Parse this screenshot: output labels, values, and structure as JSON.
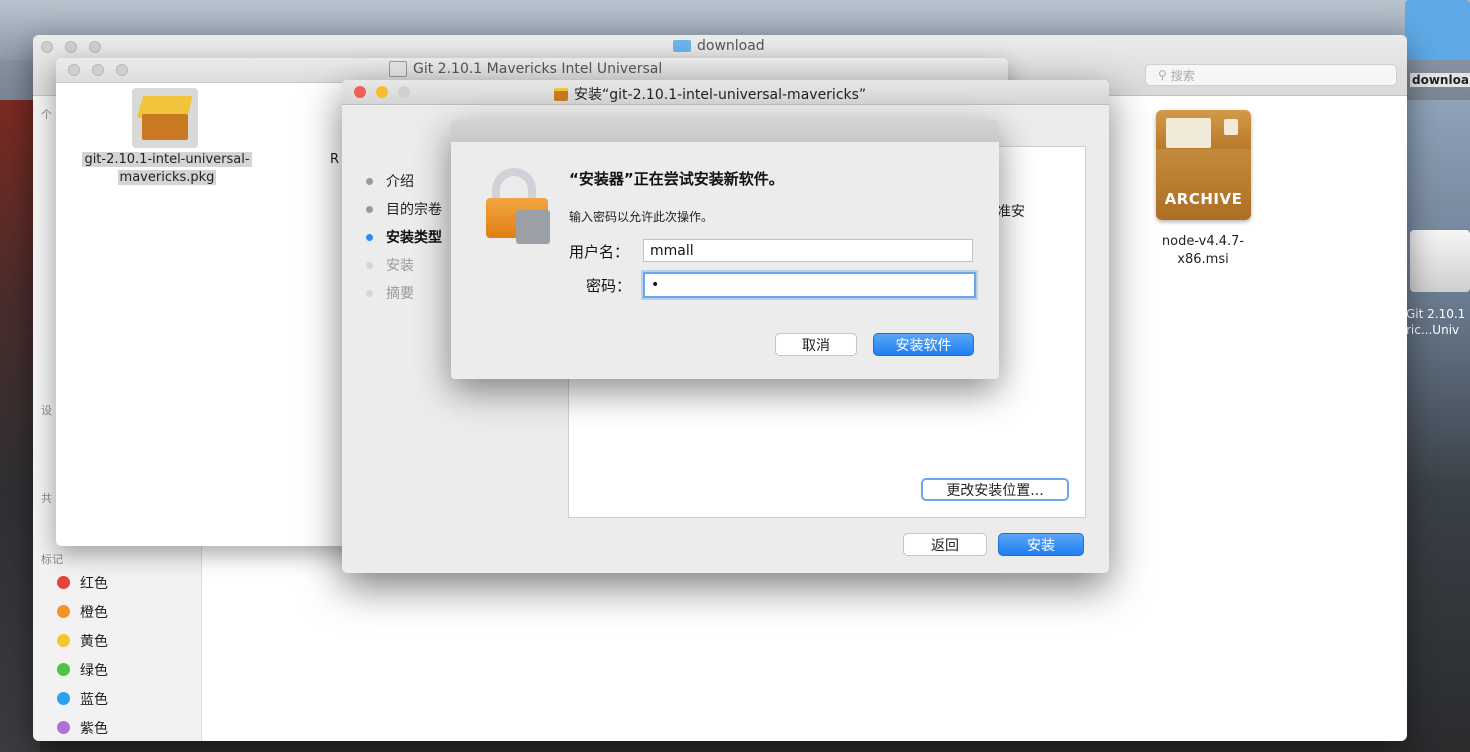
{
  "finder": {
    "title": "download",
    "search_placeholder": "搜索",
    "sidebar": {
      "section_tags": "标记",
      "section_favorites": "个",
      "section_devices": "设",
      "section_shared": "共",
      "tags": [
        {
          "label": "红色",
          "color": "#e8423a"
        },
        {
          "label": "橙色",
          "color": "#f0952c"
        },
        {
          "label": "黄色",
          "color": "#f3c531"
        },
        {
          "label": "绿色",
          "color": "#4cc640"
        },
        {
          "label": "蓝色",
          "color": "#2f9ff0"
        },
        {
          "label": "紫色",
          "color": "#b46fd6"
        }
      ]
    },
    "files": [
      {
        "name_line1": "node-v4.4.7-",
        "name_line2": "x86.msi",
        "icon": "archive-icon",
        "icon_label": "ARCHIVE"
      }
    ]
  },
  "git_window": {
    "title": "Git 2.10.1 Mavericks Intel Universal",
    "file_line1": "git-2.10.1-intel-universal-",
    "file_line2": "mavericks.pkg",
    "partial_label": "R"
  },
  "installer": {
    "title": "安装“git-2.10.1-intel-universal-mavericks”",
    "steps": [
      {
        "label": "介绍",
        "state": "done"
      },
      {
        "label": "目的宗卷",
        "state": "done"
      },
      {
        "label": "安装类型",
        "state": "current"
      },
      {
        "label": "安装",
        "state": "pending"
      },
      {
        "label": "摘要",
        "state": "pending"
      }
    ],
    "pane_partial": "准安",
    "change_location_button": "更改安装位置...",
    "back_button": "返回",
    "install_button": "安装"
  },
  "auth_sheet": {
    "heading": "“安装器”正在尝试安装新软件。",
    "subtext": "输入密码以允许此次操作。",
    "username_label": "用户名：",
    "username_value": "mmall",
    "password_label": "密码：",
    "password_value": "•",
    "cancel_button": "取消",
    "install_software_button": "安装软件"
  },
  "desktop": {
    "right_folder_label": "downloa",
    "right_volume_line1": "Git 2.10.1",
    "right_volume_line2": "ric...Univ"
  }
}
